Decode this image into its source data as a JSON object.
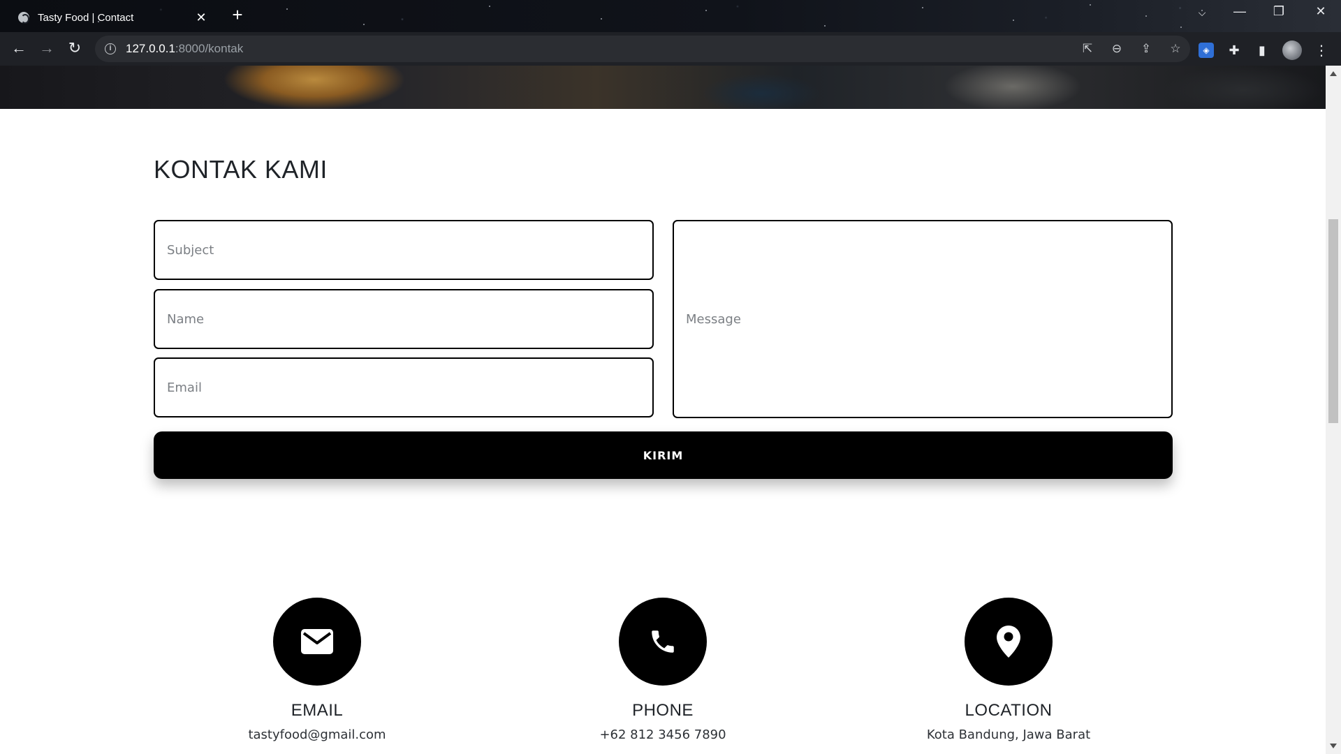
{
  "browser": {
    "tab_title": "Tasty Food | Contact",
    "url_host": "127.0.0.1",
    "url_path": ":8000/kontak"
  },
  "page": {
    "section_title": "KONTAK KAMI",
    "form": {
      "subject_placeholder": "Subject",
      "name_placeholder": "Name",
      "email_placeholder": "Email",
      "message_placeholder": "Message",
      "submit_label": "KIRIM"
    },
    "contacts": [
      {
        "label": "EMAIL",
        "value": "tastyfood@gmail.com",
        "icon": "envelope-icon"
      },
      {
        "label": "PHONE",
        "value": "+62 812 3456 7890",
        "icon": "phone-icon"
      },
      {
        "label": "LOCATION",
        "value": "Kota Bandung, Jawa Barat",
        "icon": "map-pin-icon"
      }
    ]
  },
  "colors": {
    "accent": "#000000",
    "placeholder": "#7b7f84",
    "chrome_toolbar": "#1f2126"
  }
}
